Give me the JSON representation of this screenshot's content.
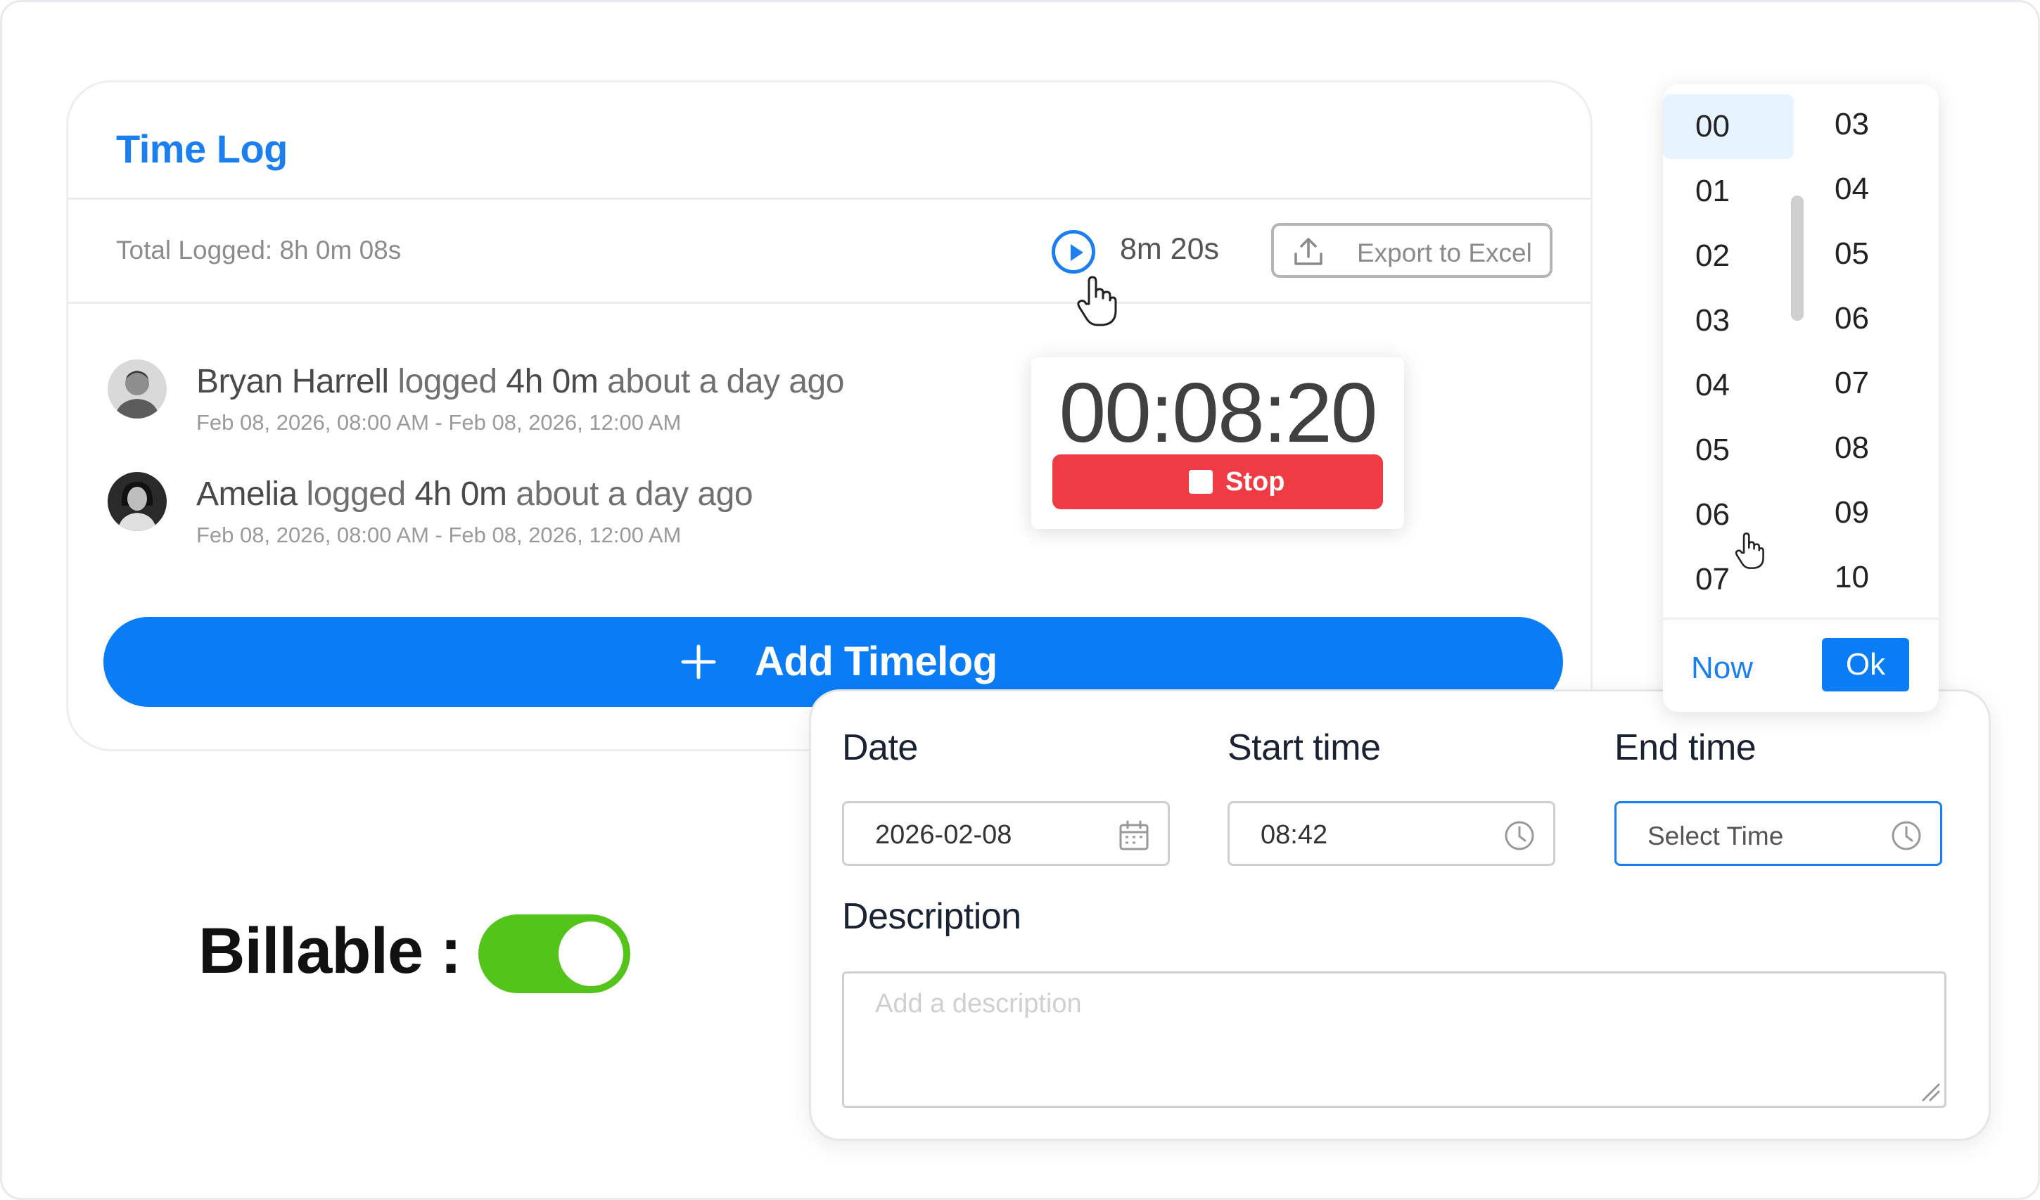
{
  "time_log": {
    "title": "Time Log",
    "total_logged": "Total Logged: 8h 0m 08s",
    "elapsed": "8m 20s",
    "export_label": "Export to Excel",
    "entries": [
      {
        "name": "Bryan Harrell",
        "verb": " logged ",
        "duration": "4h 0m",
        "when": " about a day ago",
        "range": "Feb 08, 2026, 08:00 AM - Feb 08, 2026, 12:00 AM"
      },
      {
        "name": "Amelia",
        "verb": " logged ",
        "duration": "4h 0m",
        "when": " about a day ago",
        "range": "Feb 08, 2026, 08:00 AM - Feb 08, 2026, 12:00 AM"
      }
    ],
    "add_label": "Add Timelog"
  },
  "stopwatch": {
    "time": "00:08:20",
    "stop_label": "Stop"
  },
  "billable": {
    "label": "Billable :",
    "enabled": true
  },
  "picker": {
    "hours": [
      "00",
      "01",
      "02",
      "03",
      "04",
      "05",
      "06",
      "07"
    ],
    "minutes": [
      "03",
      "04",
      "05",
      "06",
      "07",
      "08",
      "09",
      "10"
    ],
    "selected_hour": "00",
    "now_label": "Now",
    "ok_label": "Ok"
  },
  "form": {
    "date_label": "Date",
    "date_value": "2026-02-08",
    "start_label": "Start time",
    "start_value": "08:42",
    "end_label": "End time",
    "end_placeholder": "Select Time",
    "description_label": "Description",
    "description_placeholder": "Add a description"
  },
  "colors": {
    "accent": "#0a7cf5",
    "stop": "#ee3b44",
    "toggle_on": "#52c41a"
  }
}
